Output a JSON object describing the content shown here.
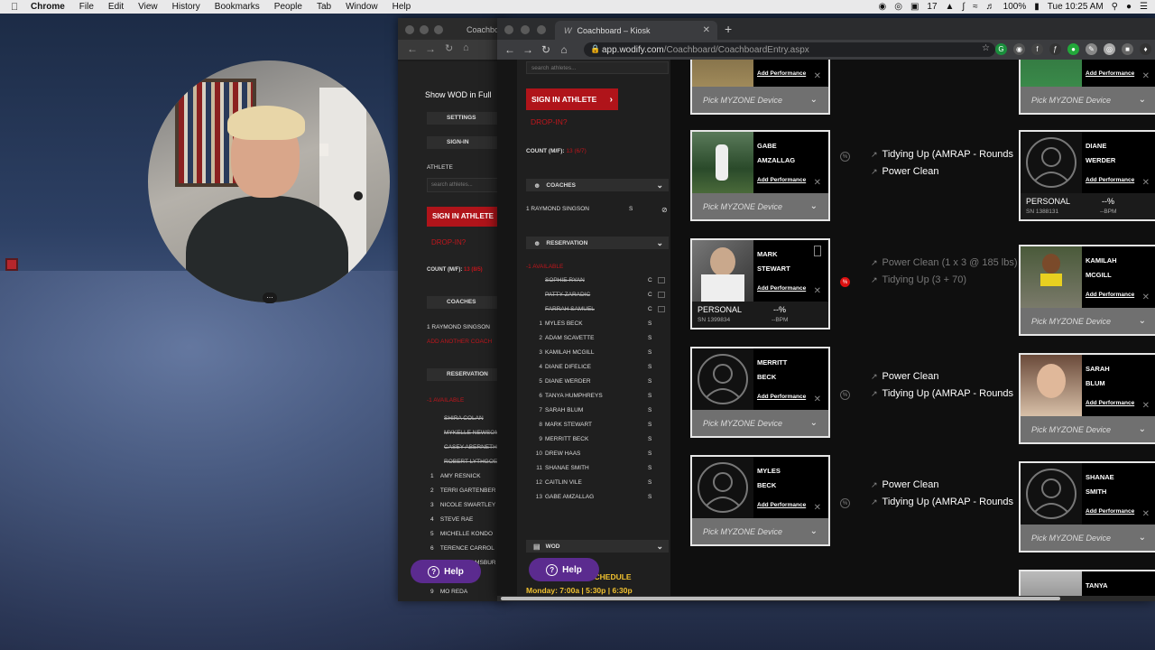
{
  "menubar": {
    "app": "Chrome",
    "items": [
      "File",
      "Edit",
      "View",
      "History",
      "Bookmarks",
      "People",
      "Tab",
      "Window",
      "Help"
    ],
    "notif_count": "17",
    "battery": "100%",
    "clock": "Tue 10:25 AM"
  },
  "back_window": {
    "tab_title": "Coachboard",
    "show_wod": "Show WOD in Full",
    "settings": "SETTINGS",
    "signin": "SIGN-IN",
    "athlete_label": "ATHLETE",
    "search_placeholder": "search athletes...",
    "sign_in_btn": "SIGN IN ATHLETE",
    "drop_in": "DROP-IN?",
    "count_label": "COUNT (M/F):",
    "count_value": "13 (8/5)",
    "coaches": "COACHES",
    "coach_1": "1 RAYMOND SINGSON",
    "add_coach": "ADD ANOTHER COACH",
    "reservation": "RESERVATION",
    "available": "-1 AVAILABLE",
    "struck": [
      "SHIRA COLAN",
      "MYKELLE NEWSOM",
      "CASEY ABERNETH"
    ],
    "robert": "ROBERT LYTHGOE",
    "list": [
      {
        "n": "1",
        "name": "AMY RESNICK"
      },
      {
        "n": "2",
        "name": "TERRI GARTENBER"
      },
      {
        "n": "3",
        "name": "NICOLE SWARTLEY"
      },
      {
        "n": "4",
        "name": "STEVE RAE"
      },
      {
        "n": "5",
        "name": "MICHELLE KONDO"
      },
      {
        "n": "6",
        "name": "TERENCE CARROL"
      },
      {
        "n": "7",
        "name": "AMANDA RAMSBUR"
      },
      {
        "n": "8",
        "name": "ER"
      },
      {
        "n": "9",
        "name": "MO REDA"
      }
    ],
    "help": "Help"
  },
  "browser": {
    "tab_title": "Coachboard – Kiosk",
    "url_host": "app.wodify.com",
    "url_path": "/Coachboard/CoachboardEntry.aspx"
  },
  "panel": {
    "search_placeholder": "search athletes...",
    "sign_in_btn": "SIGN IN ATHLETE",
    "drop_in": "DROP-IN?",
    "count_label": "COUNT (M/F):",
    "count_value": "13 (6/7)",
    "coaches": "COACHES",
    "coach_1_name": "1 RAYMOND SINGSON",
    "coach_1_status": "S",
    "reservation": "RESERVATION",
    "available": "-1 AVAILABLE",
    "rows": [
      {
        "n": "",
        "name": "SOPHIE RYAN",
        "s": "C",
        "strike": true
      },
      {
        "n": "",
        "name": "PATTY ZARADIC",
        "s": "C",
        "strike": true
      },
      {
        "n": "",
        "name": "FARRAH SAMUEL",
        "s": "C",
        "strike": true
      },
      {
        "n": "1",
        "name": "MYLES BECK",
        "s": "S",
        "strike": false
      },
      {
        "n": "2",
        "name": "ADAM SCAVETTE",
        "s": "S",
        "strike": false
      },
      {
        "n": "3",
        "name": "KAMILAH MCGILL",
        "s": "S",
        "strike": false
      },
      {
        "n": "4",
        "name": "DIANE DIFELICE",
        "s": "S",
        "strike": false
      },
      {
        "n": "5",
        "name": "DIANE WERDER",
        "s": "S",
        "strike": false
      },
      {
        "n": "6",
        "name": "TANYA HUMPHREYS",
        "s": "S",
        "strike": false
      },
      {
        "n": "7",
        "name": "SARAH BLUM",
        "s": "S",
        "strike": false
      },
      {
        "n": "8",
        "name": "MARK STEWART",
        "s": "S",
        "strike": false
      },
      {
        "n": "9",
        "name": "MERRITT BECK",
        "s": "S",
        "strike": false
      },
      {
        "n": "10",
        "name": "DREW HAAS",
        "s": "S",
        "strike": false
      },
      {
        "n": "11",
        "name": "SHANAE SMITH",
        "s": "S",
        "strike": false
      },
      {
        "n": "12",
        "name": "CAITLIN VILE",
        "s": "S",
        "strike": false
      },
      {
        "n": "13",
        "name": "GABE AMZALLAG",
        "s": "S",
        "strike": false
      }
    ],
    "wod": "WOD",
    "class_schedule": "ASS SCHEDULE",
    "schedule": "Monday: 7:00a | 5:30p | 6:30p",
    "help": "Help"
  },
  "cards": {
    "add_perf": "Add Performance",
    "pick_device": "Pick MYZONE Device",
    "left": [
      {
        "first": "",
        "last": ""
      },
      {
        "first": "GABE",
        "last": "AMZALLAG"
      },
      {
        "first": "MARK",
        "last": "STEWART",
        "personal": "PERSONAL",
        "sn": "SN 1399834",
        "pct": "--%",
        "bpm": "--BPM"
      },
      {
        "first": "MERRITT",
        "last": "BECK"
      },
      {
        "first": "MYLES",
        "last": "BECK"
      }
    ],
    "right": [
      {
        "first": "",
        "last": ""
      },
      {
        "first": "DIANE",
        "last": "WERDER",
        "personal": "PERSONAL",
        "sn": "SN 1388131",
        "pct": "--%",
        "bpm": "--BPM"
      },
      {
        "first": "KAMILAH",
        "last": "MCGILL"
      },
      {
        "first": "SARAH",
        "last": "BLUM"
      },
      {
        "first": "SHANAE",
        "last": "SMITH"
      },
      {
        "first": "TANYA",
        "last": ""
      }
    ]
  },
  "workouts": {
    "gabe": [
      "Tidying Up (AMRAP - Rounds",
      "Power Clean"
    ],
    "mark": [
      "Power Clean (1 x 3 @ 185 lbs)",
      "Tidying Up (3 + 70)"
    ],
    "merritt": [
      "Power Clean",
      "Tidying Up (AMRAP - Rounds"
    ],
    "myles": [
      "Power Clean",
      "Tidying Up (AMRAP - Rounds"
    ]
  },
  "colors": {
    "accent": "#b0141a",
    "help": "#5b2b8f",
    "schedule": "#f2c230"
  }
}
